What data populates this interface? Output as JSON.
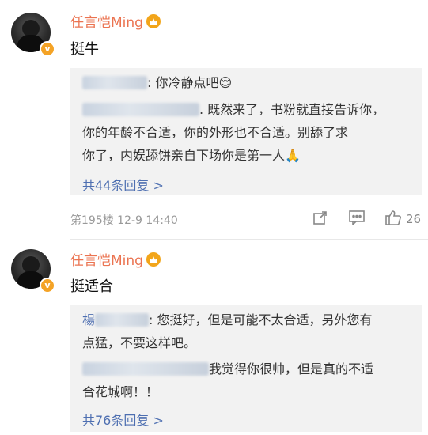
{
  "comments": [
    {
      "username": "任言恺Ming",
      "text": "挺牛",
      "replies": [
        {
          "sep": ": ",
          "text": "你冷静点吧",
          "emoji": "😌"
        },
        {
          "sep": ". ",
          "text": "既然来了，书粉就直接告诉你，"
        },
        {
          "text": "你的年龄不合适，你的外形也不合适。别舔了求"
        },
        {
          "text": "你了，内娱舔饼亲自下场你是第一人",
          "emoji": "🙏"
        }
      ],
      "more_replies": "共44条回复 >",
      "meta": "第195楼 12-9 14:40",
      "like_count": "26"
    },
    {
      "username": "任言恺Ming",
      "text": "挺适合",
      "replies": [
        {
          "prefix": "楊",
          "sep": ": ",
          "text": "您挺好，但是可能不太合适，另外您有"
        },
        {
          "text": "点猛，不要这样吧。"
        },
        {
          "text": "我觉得你很帅，但是真的不适"
        },
        {
          "text": "合花城啊！！"
        }
      ],
      "more_replies": "共76条回复 >"
    }
  ]
}
